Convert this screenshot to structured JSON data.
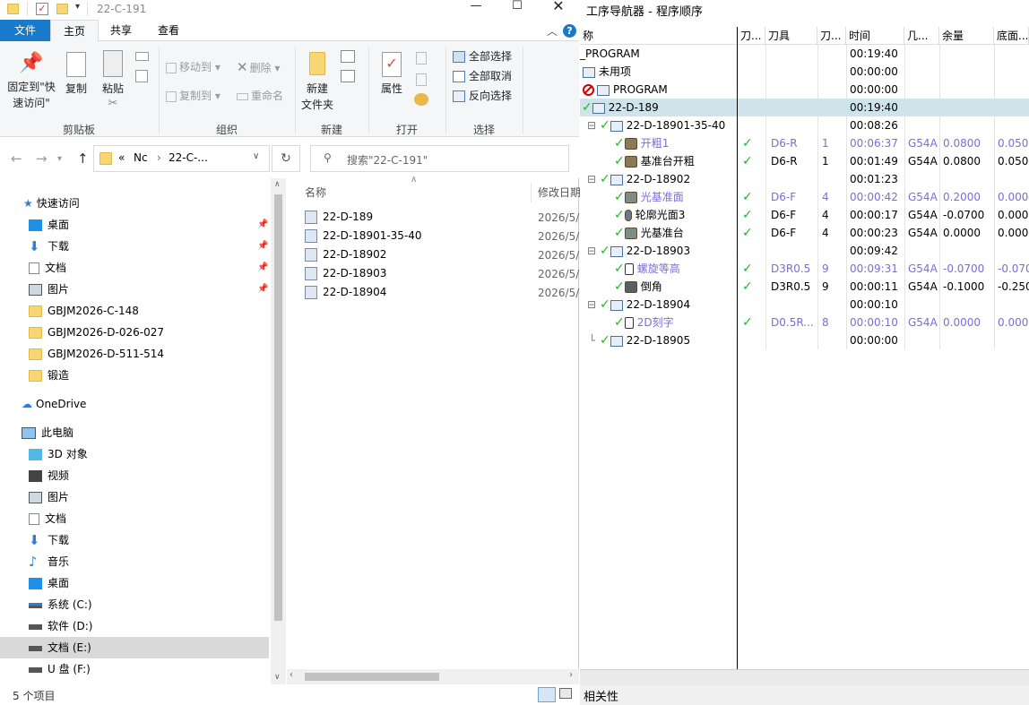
{
  "explorer": {
    "window_title": "22-C-191",
    "tabs": [
      "文件",
      "主页",
      "共享",
      "查看"
    ],
    "ribbon": {
      "clipboard": {
        "pin_label_1": "固定到\"快",
        "pin_label_2": "速访问\"",
        "copy": "复制",
        "paste": "粘贴",
        "group": "剪贴板"
      },
      "organize": {
        "move_to": "移动到",
        "copy_to": "复制到",
        "delete": "删除",
        "rename": "重命名",
        "group": "组织"
      },
      "new": {
        "new_folder_1": "新建",
        "new_folder_2": "文件夹",
        "group": "新建"
      },
      "open": {
        "properties": "属性",
        "group": "打开"
      },
      "select": {
        "select_all": "全部选择",
        "select_none": "全部取消",
        "invert": "反向选择",
        "group": "选择"
      }
    },
    "address": {
      "prefix": "«",
      "segment1": "Nc",
      "segment2": "22-C-..."
    },
    "search_placeholder": "搜索\"22-C-191\"",
    "nav": {
      "quick_access": "快速访问",
      "quick_items": [
        "桌面",
        "下载",
        "文档",
        "图片",
        "GBJM2026-C-148",
        "GBJM2026-D-026-027",
        "GBJM2026-D-511-514",
        "锻造"
      ],
      "onedrive": "OneDrive",
      "this_pc": "此电脑",
      "pc_items": [
        "3D 对象",
        "视频",
        "图片",
        "文档",
        "下载",
        "音乐",
        "桌面",
        "系统 (C:)",
        "软件 (D:)",
        "文档 (E:)",
        "U 盘 (F:)"
      ]
    },
    "columns": {
      "name": "名称",
      "date": "修改日期"
    },
    "files": [
      {
        "name": "22-D-189",
        "date": "2026/5/"
      },
      {
        "name": "22-D-18901-35-40",
        "date": "2026/5/"
      },
      {
        "name": "22-D-18902",
        "date": "2026/5/"
      },
      {
        "name": "22-D-18903",
        "date": "2026/5/"
      },
      {
        "name": "22-D-18904",
        "date": "2026/5/"
      }
    ],
    "status": "5 个项目"
  },
  "nx": {
    "title": "工序导航器 - 程序顺序",
    "headers": [
      "称",
      "刀...",
      "刀具",
      "刀...",
      "时间",
      "几...",
      "余量",
      "底面..."
    ],
    "rows": [
      {
        "name": "_PROGRAM",
        "tool": "",
        "num": "",
        "time": "00:19:40",
        "wcs": "",
        "stock": "",
        "floor": ""
      },
      {
        "name": "未用项",
        "tool": "",
        "num": "",
        "time": "00:00:00",
        "wcs": "",
        "stock": "",
        "floor": ""
      },
      {
        "name": "PROGRAM",
        "tool": "",
        "num": "",
        "time": "00:00:00",
        "wcs": "",
        "stock": "",
        "floor": ""
      },
      {
        "name": "22-D-189",
        "tool": "",
        "num": "",
        "time": "00:19:40",
        "wcs": "",
        "stock": "",
        "floor": ""
      },
      {
        "name": "22-D-18901-35-40",
        "tool": "",
        "num": "",
        "time": "00:08:26",
        "wcs": "",
        "stock": "",
        "floor": ""
      },
      {
        "name": "开粗1",
        "tool": "D6-R",
        "num": "1",
        "time": "00:06:37",
        "wcs": "G54A",
        "stock": "0.0800",
        "floor": "0.0500"
      },
      {
        "name": "基准台开粗",
        "tool": "D6-R",
        "num": "1",
        "time": "00:01:49",
        "wcs": "G54A",
        "stock": "0.0800",
        "floor": "0.0500"
      },
      {
        "name": "22-D-18902",
        "tool": "",
        "num": "",
        "time": "00:01:23",
        "wcs": "",
        "stock": "",
        "floor": ""
      },
      {
        "name": "光基准面",
        "tool": "D6-F",
        "num": "4",
        "time": "00:00:42",
        "wcs": "G54A",
        "stock": "0.2000",
        "floor": "0.0000"
      },
      {
        "name": "轮廓光面3",
        "tool": "D6-F",
        "num": "4",
        "time": "00:00:17",
        "wcs": "G54A",
        "stock": "-0.0700",
        "floor": "0.0000"
      },
      {
        "name": "光基准台",
        "tool": "D6-F",
        "num": "4",
        "time": "00:00:23",
        "wcs": "G54A",
        "stock": "0.0000",
        "floor": "0.0000"
      },
      {
        "name": "22-D-18903",
        "tool": "",
        "num": "",
        "time": "00:09:42",
        "wcs": "",
        "stock": "",
        "floor": ""
      },
      {
        "name": "螺旋等高",
        "tool": "D3R0.5",
        "num": "9",
        "time": "00:09:31",
        "wcs": "G54A",
        "stock": "-0.0700",
        "floor": "-0.070"
      },
      {
        "name": "倒角",
        "tool": "D3R0.5",
        "num": "9",
        "time": "00:00:11",
        "wcs": "G54A",
        "stock": "-0.1000",
        "floor": "-0.250"
      },
      {
        "name": "22-D-18904",
        "tool": "",
        "num": "",
        "time": "00:00:10",
        "wcs": "",
        "stock": "",
        "floor": ""
      },
      {
        "name": "2D刻字",
        "tool": "D0.5R...",
        "num": "8",
        "time": "00:00:10",
        "wcs": "G54A",
        "stock": "0.0000",
        "floor": "0.0000"
      },
      {
        "name": "22-D-18905",
        "tool": "",
        "num": "",
        "time": "00:00:00",
        "wcs": "",
        "stock": "",
        "floor": ""
      }
    ],
    "bottom_label": "相关性"
  }
}
